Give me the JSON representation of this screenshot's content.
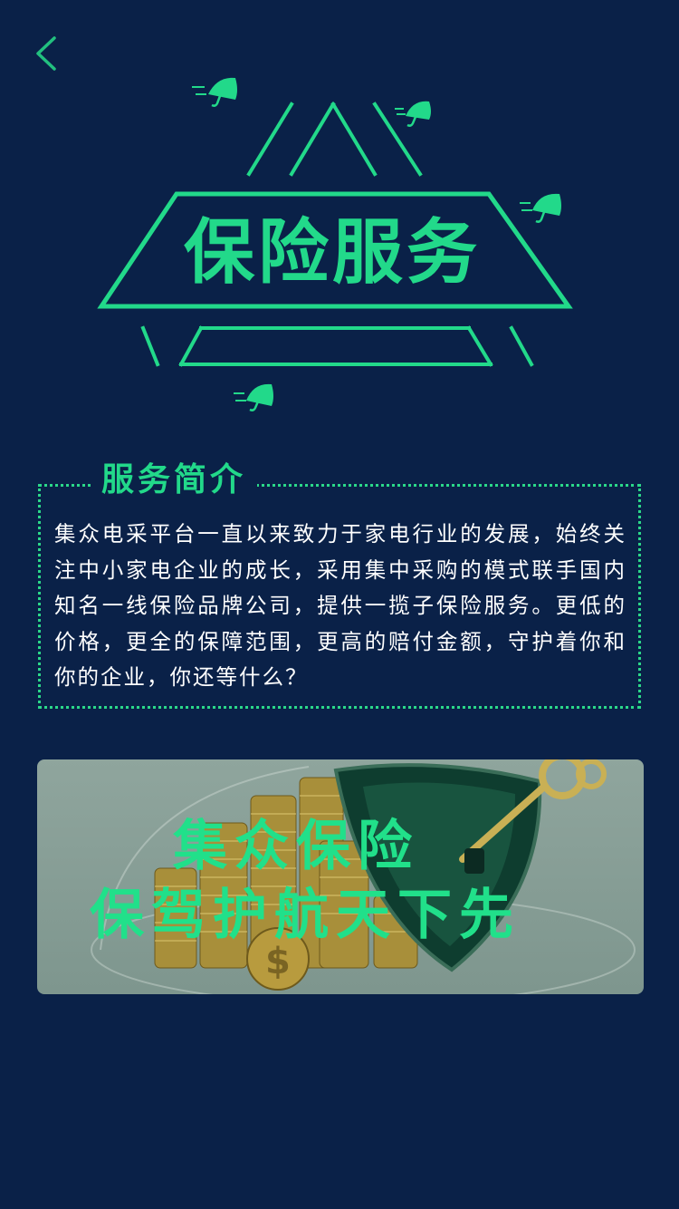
{
  "header": {
    "back_icon": "chevron-left-icon"
  },
  "hero": {
    "title": "保险服务",
    "decor_icon": "umbrella-icon",
    "accent_color": "#22d98a"
  },
  "intro": {
    "title": "服务简介",
    "text": "集众电采平台一直以来致力于家电行业的发展，始终关注中小家电企业的成长，采用集中采购的模式联手国内知名一线保险品牌公司，提供一揽子保险服务。更低的价格，更全的保障范围，更高的赔付金额，守护着你和你的企业，你还等什么？"
  },
  "banner": {
    "line1": "集众保险",
    "line2": "保驾护航天下先",
    "image_icon": "coins-shield-key-icon"
  },
  "colors": {
    "background": "#0a2148",
    "accent": "#22d98a",
    "text": "#ffffff"
  }
}
